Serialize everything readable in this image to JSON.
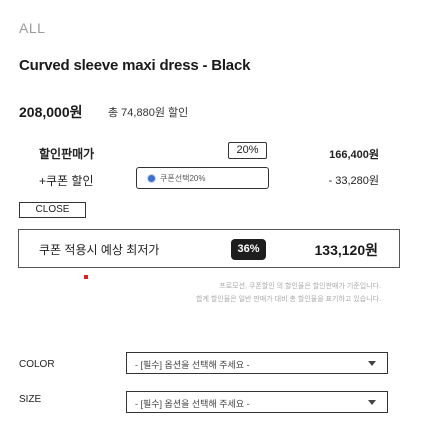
{
  "category": "ALL",
  "product": {
    "name": "Curved sleeve maxi dress - Black",
    "price": "208,000원",
    "total_discount": "총 74,880원 할인"
  },
  "sale": {
    "label": "할인판매가",
    "rate": "20%",
    "value": "166,400원"
  },
  "coupon": {
    "label": "+쿠폰 할인",
    "selected_option": "쿠폰선택20%",
    "value": "- 33,280원"
  },
  "close_label": "CLOSE",
  "best_price": {
    "label": "쿠폰 적용시 예상 최저가",
    "rate": "36%",
    "value": "133,120원"
  },
  "fine_print": {
    "line1": "프로모션, 쿠폰할인 의 할인율은 할인판매가 기준입니다.",
    "line2": "합계 할인율은 일반 판매가 대비 총 할인율을 표기하고 있습니다."
  },
  "options": {
    "color_label": "COLOR",
    "size_label": "SIZE",
    "placeholder": "- [필수] 옵션을 선택해 주세요 -"
  },
  "colors": {
    "accent_dark": "#1e1e1e",
    "marker_red": "#e02020",
    "radio_blue": "#3b6fd6"
  }
}
